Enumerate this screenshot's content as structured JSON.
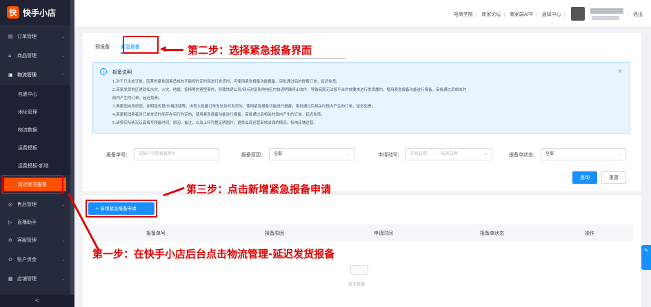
{
  "logo": {
    "mark": "快",
    "text": "快手小店"
  },
  "sidebar": {
    "items": [
      {
        "label": "订单管理",
        "icon": "order-icon"
      },
      {
        "label": "商品管理",
        "icon": "goods-icon"
      },
      {
        "label": "物流管理",
        "icon": "logistics-icon"
      }
    ],
    "subitems": [
      "包裹中心",
      "地址管理",
      "物流数据",
      "运费模板",
      "运费模板-新增",
      "延迟发货报备"
    ],
    "after": [
      {
        "label": "售后管理"
      },
      {
        "label": "直播助手"
      },
      {
        "label": "客服管理"
      },
      {
        "label": "账户资金"
      },
      {
        "label": "店铺管理"
      }
    ],
    "collapse": "<"
  },
  "topbar": {
    "links": [
      "电商学院",
      "商家论坛",
      "商家端APP",
      "通知中心"
    ],
    "logout": "退出"
  },
  "tabs": [
    "预报备",
    "紧急报备"
  ],
  "notice": {
    "title": "报备说明",
    "lines": [
      "1.对于已生成订单，因某些紧急因素造成的不能按约定时间进行发货时，可使用紧急报备功能报备，审批通过后的提报订单，延迟免责。",
      "2.商家发货地区遇到如水灾、火灾、地震、疫情等灾害型事件，导致快递公司/网点对妥影响地区内快递明确停止收件，导致商家无法按平台时效要求进行发货履约，使用紧急报备功能进行报备，审批通过后相关时",
      "段内产生的订单，延迟免责。",
      "3.商家因自身原因，如明显优惠/价格设错等，出现大批量订单无法及时发货的，使用紧急报备功能进行报备，审批通过后相关时段内产生的订单，延迟免责。",
      "4.商家和消费者对订单发货时间存在另行约定的，使用紧急报备功能进行报备，审批通过后相关时段内产生的订单，延迟免责。",
      "5.请按实际情况认真填写预备时间、原因、备注，以及上传完整证明图片，避免出现运营审核驳回的情况，影响店铺运营。"
    ]
  },
  "filters": {
    "no_label": "报备单号：",
    "no_placeholder": "请输入完整报备单号",
    "reason_label": "报备原因：",
    "reason_value": "全部",
    "time_label": "申请时间：",
    "time_start": "开始日期",
    "time_sep": "~",
    "time_end": "结束日期",
    "status_label": "报备单状态：",
    "status_value": "全部"
  },
  "buttons": {
    "query": "查询",
    "reset": "重置",
    "add": "+ 新增紧急报备申请"
  },
  "table": {
    "headers": [
      "报备单号",
      "报备原因",
      "申请时间",
      "报备单状态",
      "操作"
    ],
    "empty": "暂无数据"
  },
  "annotations": {
    "step2": "第二步：选择紧急报备界面",
    "step3": "第三步：点击新增紧急报备申请",
    "step1": "第一步：在快手小店后台点击物流管理-延迟发货报备"
  },
  "colors": {
    "accent": "#1890ff",
    "brand": "#ff5000",
    "annotation": "#e30000",
    "sidebar": "#252a3d"
  }
}
